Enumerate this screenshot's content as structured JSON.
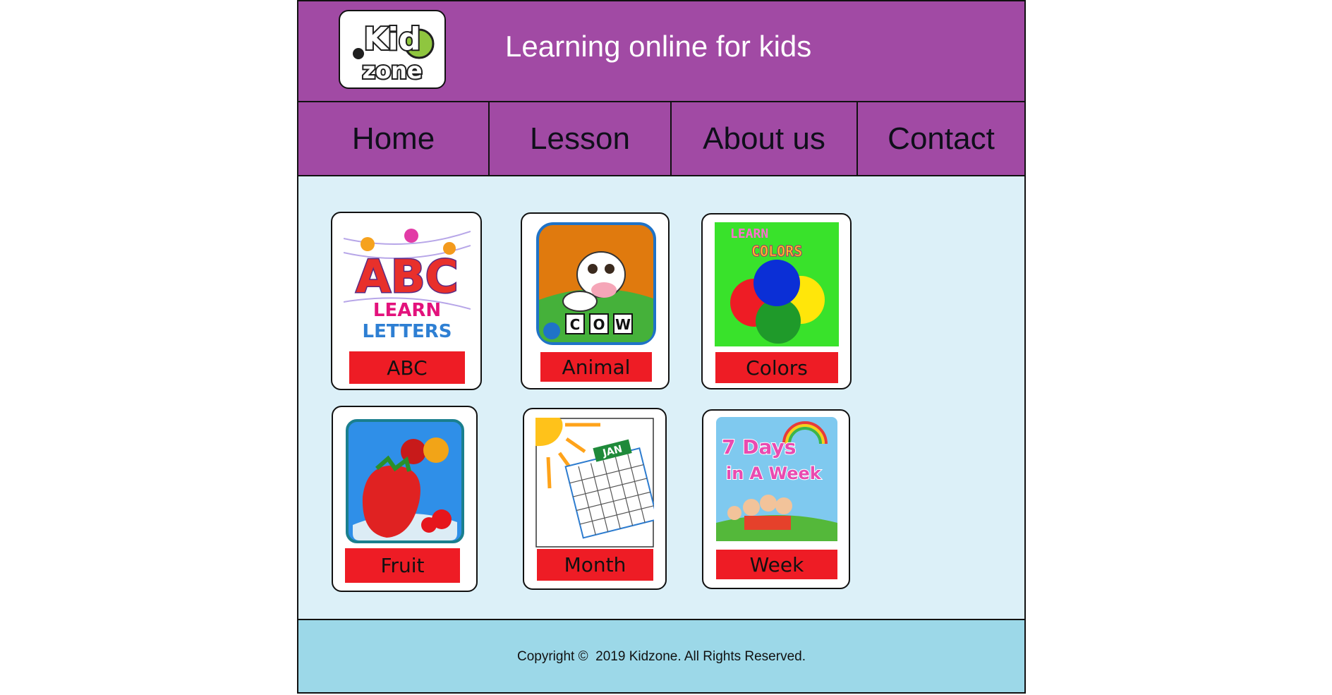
{
  "header": {
    "logo_text": [
      "Kid",
      "zone"
    ],
    "title": "Learning online for kids"
  },
  "nav": {
    "items": [
      {
        "label": "Home"
      },
      {
        "label": "Lesson"
      },
      {
        "label": "About us"
      },
      {
        "label": "Contact"
      }
    ]
  },
  "lessons": [
    {
      "label": "ABC",
      "image_text": [
        "ABC",
        "LEARN",
        "LETTERS"
      ],
      "icon": "abc-letters-image"
    },
    {
      "label": "Animal",
      "image_text": [
        "C",
        "O",
        "W"
      ],
      "icon": "cow-image"
    },
    {
      "label": "Colors",
      "image_text": [
        "LEARN",
        "COLORS"
      ],
      "icon": "color-circles-image"
    },
    {
      "label": "Fruit",
      "image_text": [],
      "icon": "fruit-image"
    },
    {
      "label": "Month",
      "image_text": [
        "JAN"
      ],
      "icon": "calendar-image"
    },
    {
      "label": "Week",
      "image_text": [
        "7 Days",
        "in A Week"
      ],
      "icon": "week-kids-image"
    }
  ],
  "footer": {
    "copyright": "Copyright ©  2019 Kidzone. All Rights Reserved."
  },
  "colors": {
    "header_purple": "#a14aa4",
    "content_bg": "#dcf0f8",
    "footer_bg": "#9cd8e8",
    "label_red": "#ee1c25"
  }
}
